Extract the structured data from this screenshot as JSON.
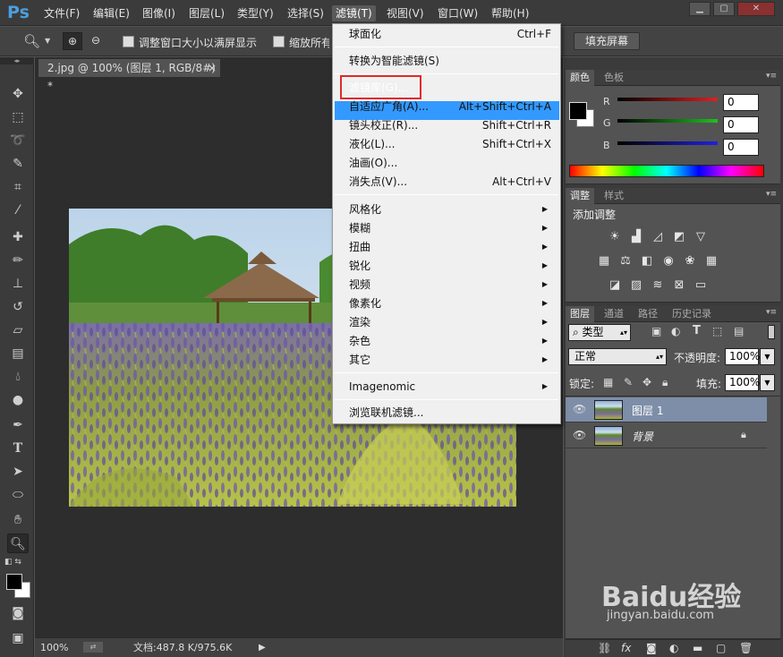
{
  "app": {
    "logo": "Ps"
  },
  "menubar": [
    {
      "label": "文件(F)",
      "active": false
    },
    {
      "label": "编辑(E)",
      "active": false
    },
    {
      "label": "图像(I)",
      "active": false
    },
    {
      "label": "图层(L)",
      "active": false
    },
    {
      "label": "类型(Y)",
      "active": false
    },
    {
      "label": "选择(S)",
      "active": false
    },
    {
      "label": "滤镜(T)",
      "active": true
    },
    {
      "label": "视图(V)",
      "active": false
    },
    {
      "label": "窗口(W)",
      "active": false
    },
    {
      "label": "帮助(H)",
      "active": false
    }
  ],
  "options": {
    "resize_windows": "调整窗口大小以满屏显示",
    "zoom_all": "缩放所有",
    "fill_screen": "填充屏幕"
  },
  "document": {
    "tab_title": "2.jpg @ 100% (图层 1, RGB/8#) *",
    "close": "×"
  },
  "status": {
    "zoom": "100%",
    "doc_size": "文档:487.8 K/975.6K"
  },
  "filter_menu": {
    "items": [
      {
        "label": "球面化",
        "shortcut": "Ctrl+F"
      },
      {
        "label": "转换为智能滤镜(S)",
        "shortcut": ""
      },
      {
        "label": "滤镜库(G)...",
        "shortcut": "",
        "highlighted": true
      },
      {
        "label": "自适应广角(A)...",
        "shortcut": "Alt+Shift+Ctrl+A"
      },
      {
        "label": "镜头校正(R)...",
        "shortcut": "Shift+Ctrl+R"
      },
      {
        "label": "液化(L)...",
        "shortcut": "Shift+Ctrl+X"
      },
      {
        "label": "油画(O)...",
        "shortcut": ""
      },
      {
        "label": "消失点(V)...",
        "shortcut": "Alt+Ctrl+V"
      },
      {
        "label": "风格化",
        "submenu": true
      },
      {
        "label": "模糊",
        "submenu": true
      },
      {
        "label": "扭曲",
        "submenu": true
      },
      {
        "label": "锐化",
        "submenu": true
      },
      {
        "label": "视频",
        "submenu": true
      },
      {
        "label": "像素化",
        "submenu": true
      },
      {
        "label": "渲染",
        "submenu": true
      },
      {
        "label": "杂色",
        "submenu": true
      },
      {
        "label": "其它",
        "submenu": true
      },
      {
        "label": "Imagenomic",
        "submenu": true
      },
      {
        "label": "浏览联机滤镜..."
      }
    ]
  },
  "color_panel": {
    "tabs": [
      "颜色",
      "色板"
    ],
    "channels": [
      {
        "label": "R",
        "value": "0",
        "color": "#e02020"
      },
      {
        "label": "G",
        "value": "0",
        "color": "#20c020"
      },
      {
        "label": "B",
        "value": "0",
        "color": "#2020e0"
      }
    ]
  },
  "adjust_panel": {
    "tabs": [
      "调整",
      "样式"
    ],
    "title": "添加调整"
  },
  "layers_panel": {
    "tabs": [
      "图层",
      "通道",
      "路径",
      "历史记录"
    ],
    "filter_kind": "类型",
    "blend_mode": "正常",
    "opacity_label": "不透明度:",
    "opacity": "100%",
    "lock_label": "锁定:",
    "fill_label": "填充:",
    "fill": "100%",
    "layers": [
      {
        "name": "图层 1",
        "selected": true,
        "locked": false
      },
      {
        "name": "背景",
        "selected": false,
        "locked": true
      }
    ]
  },
  "watermark": {
    "brand": "Baidu经验",
    "url": "jingyan.baidu.com"
  },
  "colors": {
    "highlight": "#3399ff",
    "red_box": "#e02a2a",
    "ps_blue": "#4a9fe0"
  }
}
